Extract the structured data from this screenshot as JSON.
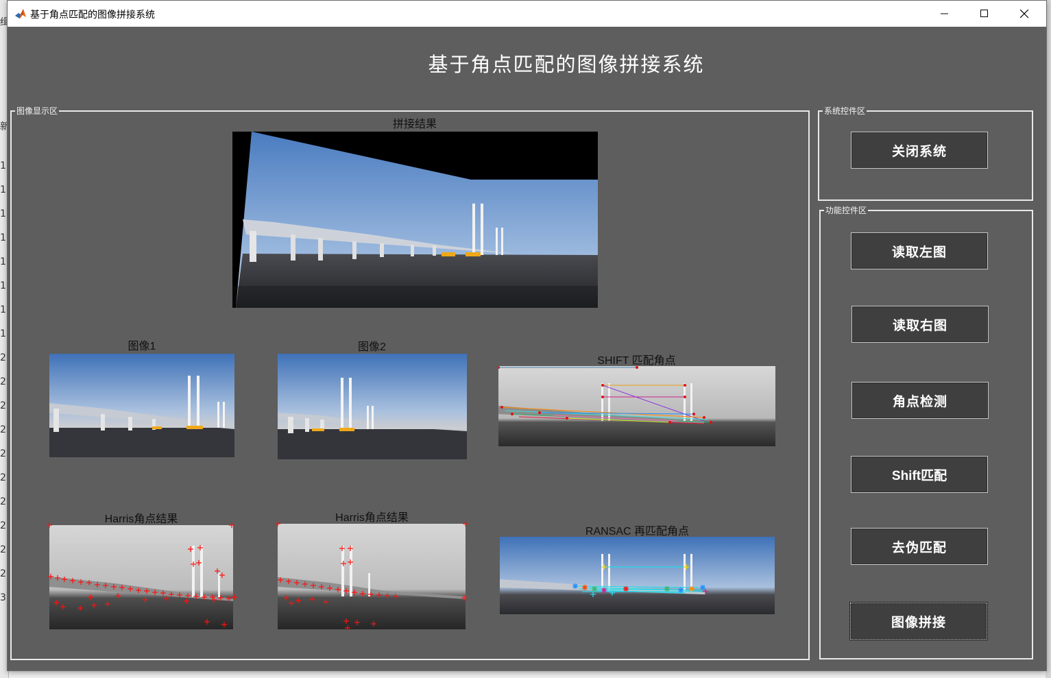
{
  "window": {
    "title": "基于角点匹配的图像拼接系统",
    "app_icon": "matlab-icon",
    "controls": [
      "minimize-icon",
      "maximize-icon",
      "close-icon"
    ]
  },
  "background_app": {
    "left_strip_chars": [
      "缉",
      "新",
      "1",
      "1",
      "1",
      "1",
      "1",
      "1",
      "1",
      "1",
      "2",
      "2",
      "2",
      "2",
      "2",
      "2",
      "2",
      "2",
      "2",
      "2",
      "3"
    ]
  },
  "header": {
    "title": "基于角点匹配的图像拼接系统"
  },
  "image_panel": {
    "label": "图像显示区",
    "stitch": {
      "title": "拼接结果"
    },
    "image1": {
      "title": "图像1"
    },
    "image2": {
      "title": "图像2"
    },
    "shift": {
      "title": "SHIFT 匹配角点"
    },
    "harris1": {
      "title": "Harris角点结果"
    },
    "harris2": {
      "title": "Harris角点结果"
    },
    "ransac": {
      "title": "RANSAC 再匹配角点"
    }
  },
  "system_panel": {
    "label": "系统控件区",
    "close_button": "关闭系统"
  },
  "function_panel": {
    "label": "功能控件区",
    "buttons": [
      "读取左图",
      "读取右图",
      "角点检测",
      "Shift匹配",
      "去伪匹配",
      "图像拼接"
    ]
  },
  "colors": {
    "window_bg": "#5e5e5e",
    "button_bg": "#3f3f3f",
    "panel_border": "#e9e9e9",
    "corner_marker": "#ff1010"
  }
}
